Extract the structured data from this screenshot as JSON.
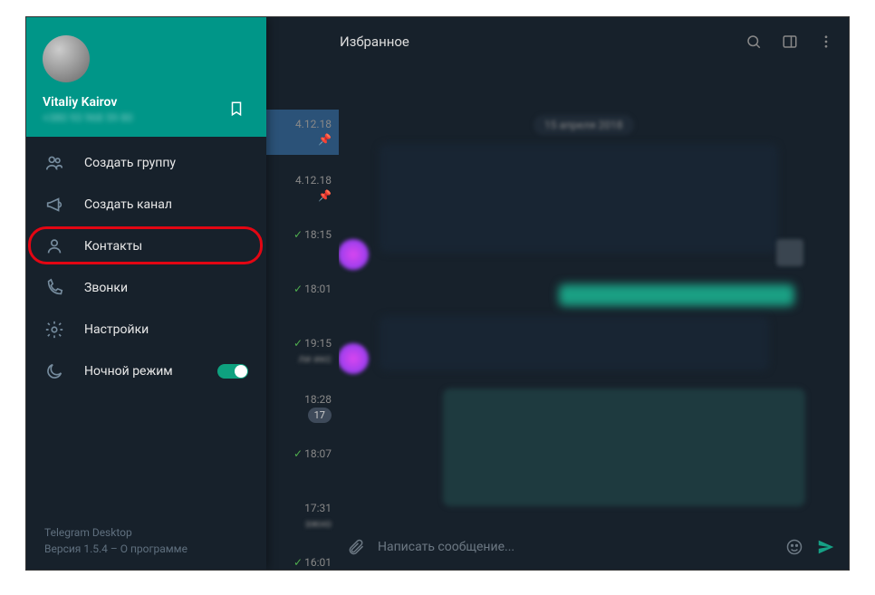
{
  "window": {
    "minimize": "—",
    "maximize": "☐",
    "close": "✕"
  },
  "chat": {
    "title": "Избранное",
    "date_pill": "15 апреля 2018",
    "input_placeholder": "Написать сообщение..."
  },
  "drawer": {
    "user_name": "Vitaliy Kairov",
    "user_phone": "+380 93 968 59 80",
    "menu": {
      "new_group": "Создать группу",
      "new_channel": "Создать канал",
      "contacts": "Контакты",
      "calls": "Звонки",
      "settings": "Настройки",
      "night_mode": "Ночной режим"
    },
    "night_mode_on": true,
    "footer_app": "Telegram Desktop",
    "footer_ver": "Версия 1.5.4 – О программе"
  },
  "chatlist": [
    {
      "time": "4.12.18",
      "pinned": true,
      "active": true
    },
    {
      "time": "4.12.18",
      "pinned": true
    },
    {
      "time": "18:15",
      "check": true
    },
    {
      "time": "18:01",
      "check": true
    },
    {
      "time": "19:15",
      "check": true,
      "sub": "ли икс"
    },
    {
      "time": "18:28",
      "badge": "17"
    },
    {
      "time": "18:07",
      "check": true
    },
    {
      "time": "17:31",
      "sub": "эжно"
    },
    {
      "time": "16:01",
      "check": true
    }
  ]
}
